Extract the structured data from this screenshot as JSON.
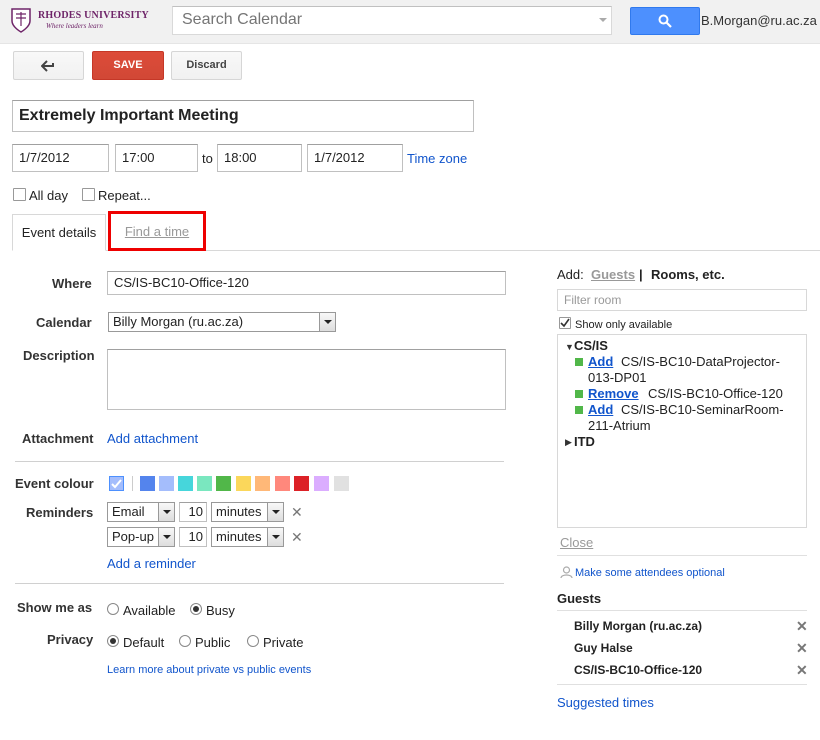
{
  "header": {
    "logo_title": "RHODES UNIVERSITY",
    "logo_tagline": "Where leaders learn",
    "search_placeholder": "Search Calendar",
    "user_email": "B.Morgan@ru.ac.za"
  },
  "toolbar": {
    "back_icon": "back-arrow-icon",
    "save_label": "SAVE",
    "discard_label": "Discard"
  },
  "event": {
    "title": "Extremely Important Meeting",
    "start_date": "1/7/2012",
    "start_time": "17:00",
    "to_label": "to",
    "end_time": "18:00",
    "end_date": "1/7/2012",
    "timezone_label": "Time zone",
    "all_day_label": "All day",
    "repeat_label": "Repeat..."
  },
  "tabs": [
    {
      "label": "Event details",
      "active": true
    },
    {
      "label": "Find a time",
      "active": false,
      "highlighted": true
    }
  ],
  "details": {
    "where_label": "Where",
    "where_value": "CS/IS-BC10-Office-120",
    "calendar_label": "Calendar",
    "calendar_value": "Billy Morgan (ru.ac.za)",
    "description_label": "Description",
    "attachment_label": "Attachment",
    "add_attachment": "Add attachment",
    "event_colour_label": "Event colour",
    "colours": [
      "#a4bdfc",
      "#5484ed",
      "#a4bdfc",
      "#46d6db",
      "#7ae7bf",
      "#51b749",
      "#fbd75b",
      "#ffb878",
      "#ff887c",
      "#dc2127",
      "#dbadff",
      "#e1e1e1"
    ],
    "reminders_label": "Reminders",
    "reminders": [
      {
        "method": "Email",
        "amount": "10",
        "unit": "minutes"
      },
      {
        "method": "Pop-up",
        "amount": "10",
        "unit": "minutes"
      }
    ],
    "add_reminder": "Add a reminder",
    "show_me_as_label": "Show me as",
    "availability": {
      "available": "Available",
      "busy": "Busy",
      "selected": "Busy"
    },
    "privacy_label": "Privacy",
    "privacy": {
      "default": "Default",
      "public": "Public",
      "private": "Private",
      "selected": "Default"
    },
    "learn_more": "Learn more about private vs public events"
  },
  "rooms": {
    "add_label": "Add:",
    "guests_tab": "Guests",
    "separator": "|",
    "rooms_tab": "Rooms, etc.",
    "filter_placeholder": "Filter room",
    "show_only_available": "Show only available",
    "group_csis": "CS/IS",
    "items": [
      {
        "action": "Add",
        "name_line1": "CS/IS-BC10-DataProjector-",
        "name_line2": "013-DP01"
      },
      {
        "action": "Remove",
        "name_line1": "CS/IS-BC10-Office-120",
        "name_line2": ""
      },
      {
        "action": "Add",
        "name_line1": "CS/IS-BC10-SeminarRoom-",
        "name_line2": "211-Atrium"
      }
    ],
    "group_itd": "ITD",
    "close_label": "Close",
    "optional_link": "Make some attendees optional"
  },
  "guests": {
    "heading": "Guests",
    "list": [
      "Billy Morgan (ru.ac.za)",
      "Guy Halse",
      "CS/IS-BC10-Office-120"
    ],
    "suggested_times": "Suggested times"
  }
}
